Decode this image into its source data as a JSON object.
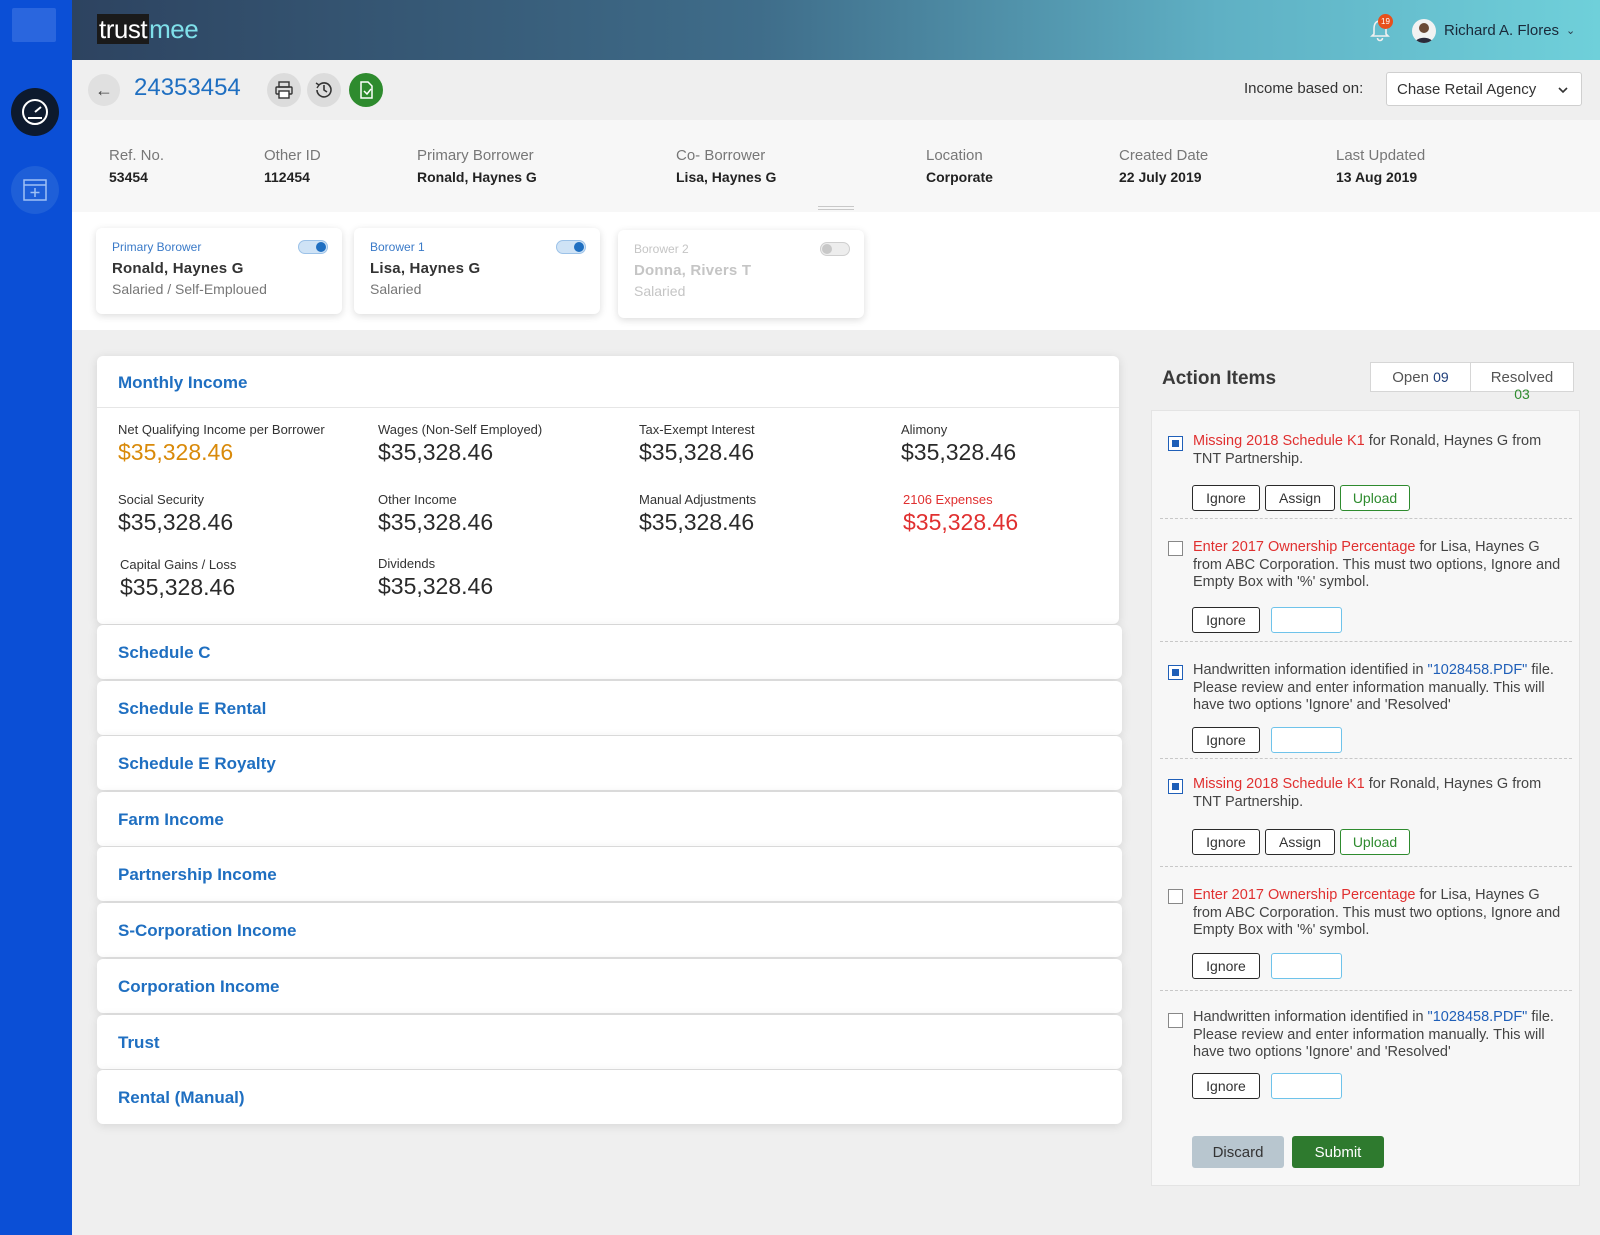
{
  "brand": {
    "part1": "trust",
    "part2": "mee"
  },
  "topbar": {
    "notification_count": "19",
    "user_name": "Richard A. Flores",
    "caret": "⌄"
  },
  "header": {
    "back_glyph": "←",
    "loan_id": "24353454",
    "income_based_label": "Income based on:",
    "income_based_value": "Chase Retail Agency"
  },
  "info": {
    "ref_label": "Ref. No.",
    "ref_value": "53454",
    "other_label": "Other ID",
    "other_value": "112454",
    "primary_label": "Primary Borrower",
    "primary_value": "Ronald, Haynes G",
    "co_label": "Co- Borrower",
    "co_value": "Lisa, Haynes G",
    "location_label": "Location",
    "location_value": "Corporate",
    "created_label": "Created Date",
    "created_value": "22 July 2019",
    "updated_label": "Last Updated",
    "updated_value": "13 Aug 2019"
  },
  "borrowers": [
    {
      "label": "Primary Borower",
      "name": "Ronald, Haynes G",
      "type": "Salaried / Self-Emploued",
      "enabled": true
    },
    {
      "label": "Borower 1",
      "name": "Lisa, Haynes G",
      "type": "Salaried",
      "enabled": true
    },
    {
      "label": "Borower 2",
      "name": "Donna, Rivers T",
      "type": "Salaried",
      "enabled": false
    }
  ],
  "monthly_income": {
    "title": "Monthly Income",
    "metrics": [
      {
        "label": "Net Qualifying Income per Borrower",
        "value": "$35,328.46"
      },
      {
        "label": "Wages (Non-Self Employed)",
        "value": "$35,328.46"
      },
      {
        "label": "Tax-Exempt Interest",
        "value": "$35,328.46"
      },
      {
        "label": "Alimony",
        "value": "$35,328.46"
      },
      {
        "label": "Social Security",
        "value": "$35,328.46"
      },
      {
        "label": "Other Income",
        "value": "$35,328.46"
      },
      {
        "label": "Manual Adjustments",
        "value": "$35,328.46"
      },
      {
        "label": "2106 Expenses",
        "value": "$35,328.46"
      },
      {
        "label": "Capital Gains / Loss",
        "value": "$35,328.46"
      },
      {
        "label": "Dividends",
        "value": "$35,328.46"
      }
    ]
  },
  "sections": [
    "Schedule C",
    "Schedule E Rental",
    "Schedule E Royalty",
    "Farm Income",
    "Partnership Income",
    "S-Corporation Income",
    "Corporation Income",
    "Trust",
    "Rental (Manual)"
  ],
  "actions": {
    "title": "Action Items",
    "open_label": "Open",
    "open_count": "09",
    "resolved_label": "Resolved",
    "resolved_count": "03",
    "items": [
      {
        "highlight": "Missing 2018 Schedule K1",
        "rest": " for Ronald, Haynes G from TNT Partnership.",
        "checked": true
      },
      {
        "highlight": "Enter 2017 Ownership Percentage",
        "rest": " for Lisa, Haynes G from ABC Corporation. This must two options, Ignore and Empty Box with '%' symbol.",
        "checked": false
      },
      {
        "pre": "Handwritten information identified in ",
        "link": "\"1028458.PDF\"",
        "rest": " file. Please review and enter information manually. This will have two options 'Ignore' and 'Resolved'",
        "checked": true
      },
      {
        "highlight": "Missing 2018 Schedule K1",
        "rest": " for Ronald, Haynes G from TNT Partnership.",
        "checked": true
      },
      {
        "highlight": "Enter 2017 Ownership Percentage",
        "rest": " for Lisa, Haynes G from ABC Corporation. This must two options, Ignore and Empty Box with '%' symbol.",
        "checked": false
      },
      {
        "pre": "Handwritten information identified in ",
        "link": "\"1028458.PDF\"",
        "rest": " file. Please review and enter information manually. This will have two options 'Ignore' and 'Resolved'",
        "checked": false
      }
    ],
    "ignore_label": "Ignore",
    "assign_label": "Assign",
    "upload_label": "Upload",
    "discard_label": "Discard",
    "submit_label": "Submit"
  },
  "colors": {
    "accent": "#1f6fc1",
    "rail": "#0b4fd6",
    "submit": "#2e7a2e",
    "warning": "#e03030",
    "highlight_value": "#d98a0a"
  }
}
